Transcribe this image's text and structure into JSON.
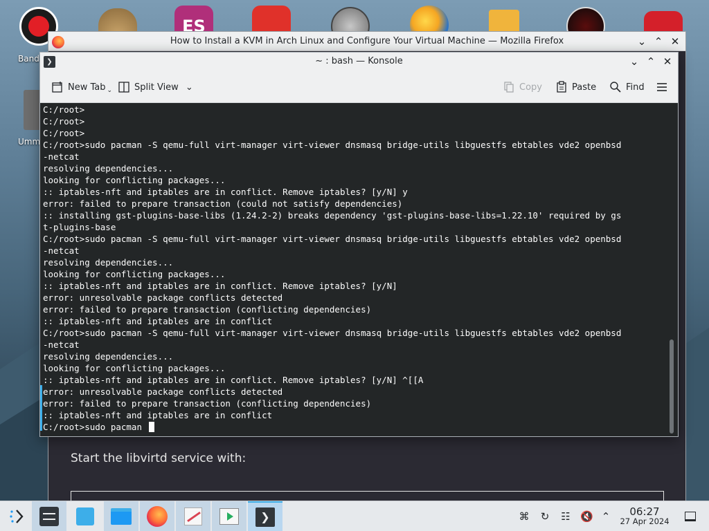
{
  "desktop": {
    "icons": [
      {
        "name": "bandicam",
        "label": "Band"
      },
      {
        "name": "money-bag",
        "label": ""
      },
      {
        "name": "es-file",
        "label": ""
      },
      {
        "name": "wps-office",
        "label": ""
      },
      {
        "name": "speedometer",
        "label": ""
      },
      {
        "name": "weather",
        "label": ""
      },
      {
        "name": "network",
        "label": ""
      },
      {
        "name": "dark-app",
        "label": ""
      },
      {
        "name": "red-app",
        "label": ""
      }
    ],
    "second_row_label": "Umm"
  },
  "firefox": {
    "title": "How to Install a KVM in Arch Linux and Configure Your Virtual Machine — Mozilla Firefox",
    "content_text": "Start the libvirtd service with:"
  },
  "konsole": {
    "title": "~ : bash — Konsole",
    "toolbar": {
      "new_tab": "New Tab",
      "split_view": "Split View",
      "copy": "Copy",
      "paste": "Paste",
      "find": "Find"
    },
    "lines": [
      "C:/root>",
      "C:/root>",
      "C:/root>",
      "C:/root>sudo pacman -S qemu-full virt-manager virt-viewer dnsmasq bridge-utils libguestfs ebtables vde2 openbsd",
      "-netcat",
      "resolving dependencies...",
      "looking for conflicting packages...",
      ":: iptables-nft and iptables are in conflict. Remove iptables? [y/N] y",
      "error: failed to prepare transaction (could not satisfy dependencies)",
      ":: installing gst-plugins-base-libs (1.24.2-2) breaks dependency 'gst-plugins-base-libs=1.22.10' required by gs",
      "t-plugins-base",
      "C:/root>sudo pacman -S qemu-full virt-manager virt-viewer dnsmasq bridge-utils libguestfs ebtables vde2 openbsd",
      "-netcat",
      "resolving dependencies...",
      "looking for conflicting packages...",
      ":: iptables-nft and iptables are in conflict. Remove iptables? [y/N]",
      "error: unresolvable package conflicts detected",
      "error: failed to prepare transaction (conflicting dependencies)",
      ":: iptables-nft and iptables are in conflict",
      "C:/root>sudo pacman -S qemu-full virt-manager virt-viewer dnsmasq bridge-utils libguestfs ebtables vde2 openbsd",
      "-netcat",
      "resolving dependencies...",
      "looking for conflicting packages...",
      ":: iptables-nft and iptables are in conflict. Remove iptables? [y/N] ^[[A",
      "error: unresolvable package conflicts detected",
      "error: failed to prepare transaction (conflicting dependencies)",
      ":: iptables-nft and iptables are in conflict"
    ],
    "prompt_line": "C:/root>sudo pacman "
  },
  "taskbar": {
    "clock_time": "06:27",
    "clock_date": "27 Apr 2024"
  }
}
